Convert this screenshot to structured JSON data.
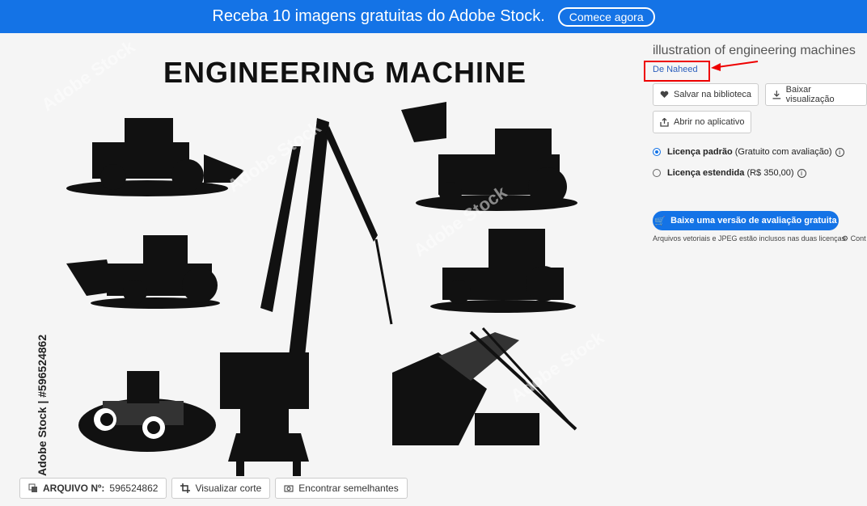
{
  "banner": {
    "text": "Receba 10 imagens gratuitas do Adobe Stock.",
    "cta": "Comece agora"
  },
  "preview": {
    "poster_title": "ENGINEERING MACHINE",
    "side_watermark": "Adobe Stock | #596524862",
    "watermark_text": "Adobe Stock"
  },
  "bottom_bar": {
    "file_label": "ARQUIVO Nº:",
    "file_number": "596524862",
    "crop_label": "Visualizar corte",
    "similar_label": "Encontrar semelhantes"
  },
  "details": {
    "title": "illustration of engineering machines",
    "author": "De Naheed",
    "save_label": "Salvar na biblioteca",
    "download_label": "Baixar visualização",
    "open_label": "Abrir no aplicativo",
    "license_standard": "Licença padrão",
    "license_standard_note": "(Gratuito com avaliação)",
    "license_extended": "Licença estendida",
    "license_extended_price": "(R$ 350,00)",
    "note": "Arquivos vetoriais e JPEG estão inclusos nas duas licenças",
    "note_extra": "Cont",
    "cta": "Baixe uma versão de avaliação gratuita"
  }
}
